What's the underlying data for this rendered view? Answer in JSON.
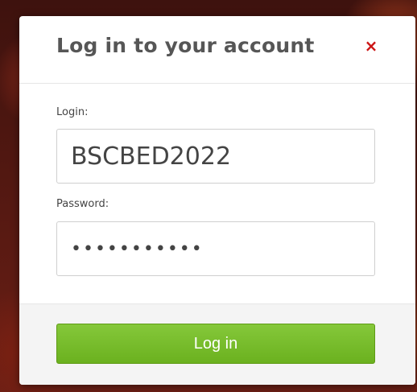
{
  "dialog": {
    "title": "Log in to your account",
    "close_symbol": "×"
  },
  "form": {
    "login_label": "Login:",
    "login_value": "BSCBED2022",
    "password_label": "Password:",
    "password_masked": "•••••••••••"
  },
  "footer": {
    "submit_label": "Log in"
  },
  "colors": {
    "accent": "#74b928",
    "close": "#cc1414",
    "backdrop": "#5a1a14"
  }
}
